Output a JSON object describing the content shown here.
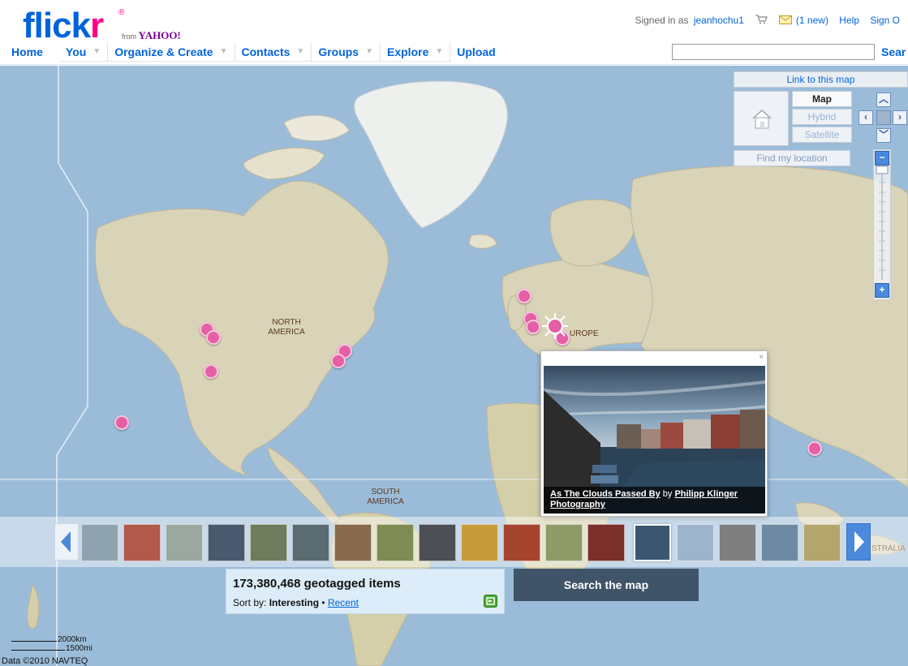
{
  "header": {
    "logo_text_a": "flick",
    "logo_text_b": "r",
    "logo_reg": "®",
    "logo_from": "from",
    "logo_yahoo": "YAHOO!",
    "signed_in_prefix": "Signed in as",
    "username": "jeanhochu1",
    "mail_new": "(1 new)",
    "help": "Help",
    "sign_out": "Sign O"
  },
  "nav": {
    "home": "Home",
    "you": "You",
    "organize": "Organize & Create",
    "contacts": "Contacts",
    "groups": "Groups",
    "explore": "Explore",
    "upload": "Upload",
    "search_button": "Sear",
    "search_value": ""
  },
  "map": {
    "label_north_america_1": "NORTH",
    "label_north_america_2": "AMERICA",
    "label_europe": "UROPE",
    "label_south_america_1": "SOUTH",
    "label_south_america_2": "AMERICA",
    "label_australia": "STRALIA"
  },
  "controls": {
    "link_to_map": "Link to this map",
    "map": "Map",
    "hybrid": "Hybrid",
    "satellite": "Satellite",
    "find_my_location": "Find my location"
  },
  "popup": {
    "close": "×",
    "title": "As The Clouds Passed By",
    "by": "by",
    "author": "Philipp Klinger Photography"
  },
  "panel": {
    "count": "173,380,468 geotagged items",
    "sort_label": "Sort by:",
    "sort_interesting": "Interesting",
    "sort_sep": "•",
    "sort_recent": "Recent",
    "search_map": "Search the map"
  },
  "scale": {
    "km": "2000km",
    "mi": "1500mi"
  },
  "attribution": "Data ©2010 NAVTEQ",
  "colors": {
    "flickr_blue": "#0063dc",
    "flickr_pink": "#ff0084",
    "marker": "#e45fa6",
    "ocean": "#9bbcd9",
    "land": "#d9d3b8"
  }
}
